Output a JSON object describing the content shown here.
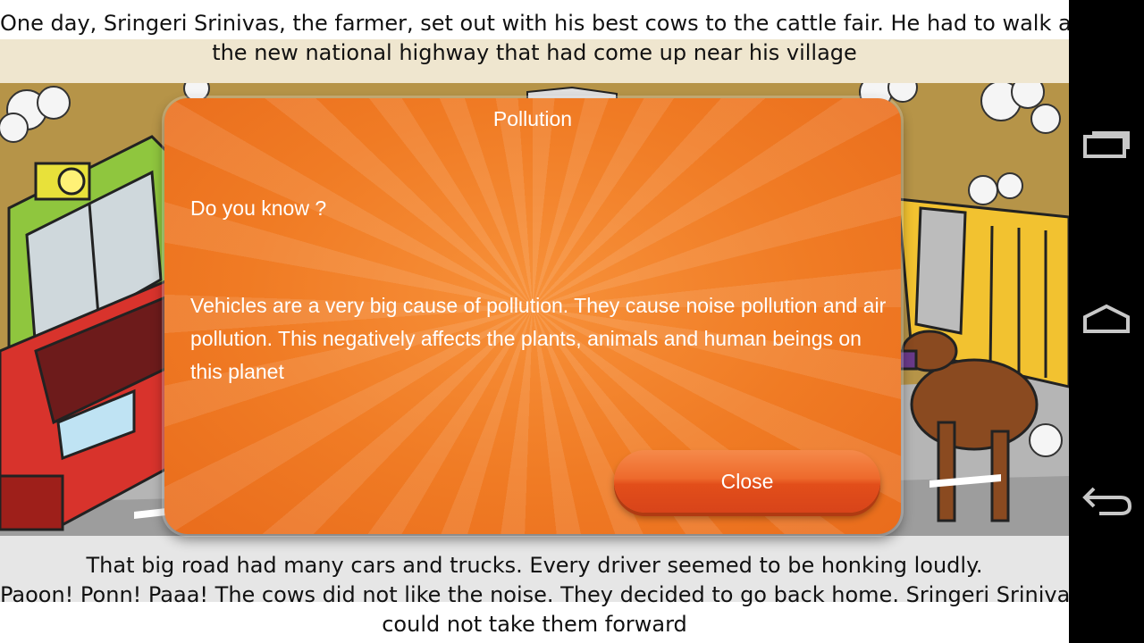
{
  "story": {
    "top_caption": [
      "One day, Sringeri Srinivas, the farmer, set out with his best cows to the cattle fair. He had to walk along",
      "the new national highway that had come up near his village"
    ],
    "bottom_caption": [
      "That big road had many cars and trucks. Every driver seemed to be honking loudly.",
      "Paoon! Ponn! Paaa! The cows did not like the noise. They decided to go back home. Sringeri Srinivas just",
      "could not take them forward"
    ]
  },
  "dialog": {
    "title": "Pollution",
    "question": "Do you know ?",
    "body": "Vehicles are a very big cause of pollution. They cause noise pollution and air pollution. This negatively affects the plants, animals and human beings on this planet",
    "close_label": "Close"
  },
  "navbar": {
    "buttons": [
      "recent-apps-icon",
      "home-icon",
      "back-icon"
    ]
  },
  "colors": {
    "dialog_orange": "#f07b24",
    "button_orange": "#e24e1a",
    "caption_band": "#efe6cf",
    "navbar": "#000000"
  }
}
